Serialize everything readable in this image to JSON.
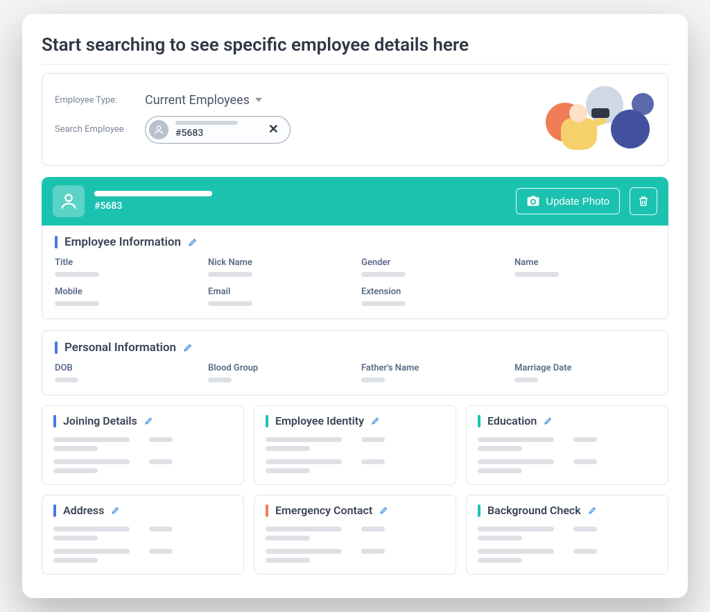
{
  "page": {
    "title": "Start searching to see specific employee details here"
  },
  "search": {
    "type_label": "Employee Type:",
    "type_value": "Current Employees",
    "search_label": "Search Employee",
    "chip_text": "#5683"
  },
  "employee_header": {
    "id": "#5683",
    "update_photo": "Update Photo"
  },
  "sections": {
    "info": {
      "title": "Employee Information",
      "fields": {
        "title": "Title",
        "nick": "Nick Name",
        "gender": "Gender",
        "name": "Name",
        "mobile": "Mobile",
        "email": "Email",
        "extension": "Extension"
      }
    },
    "personal": {
      "title": "Personal Information",
      "fields": {
        "dob": "DOB",
        "blood": "Blood Group",
        "father": "Father's Name",
        "marriage": "Marriage Date"
      }
    },
    "joining": {
      "title": "Joining Details"
    },
    "identity": {
      "title": "Employee Identity"
    },
    "education": {
      "title": "Education"
    },
    "address": {
      "title": "Address"
    },
    "emergency": {
      "title": "Emergency Contact"
    },
    "background": {
      "title": "Background Check"
    }
  }
}
